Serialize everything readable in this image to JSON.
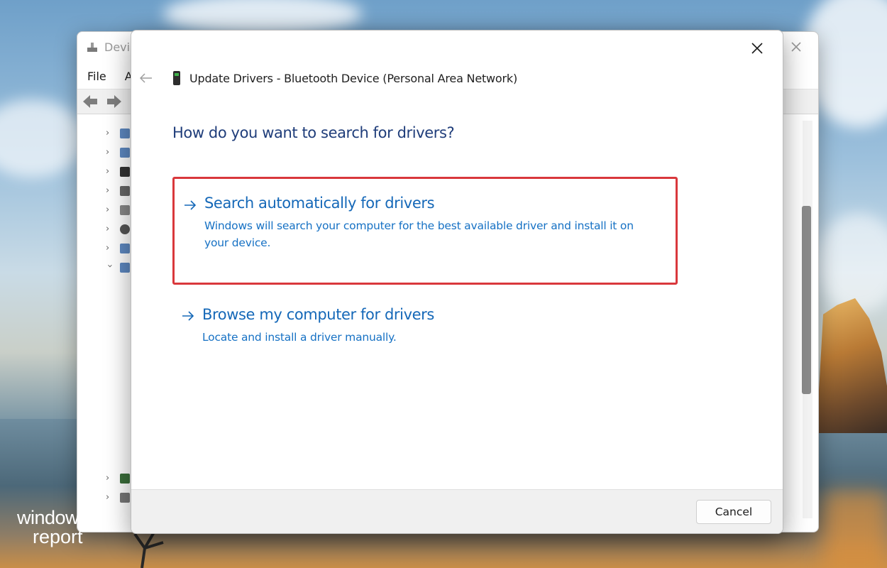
{
  "background_window": {
    "title": "Devi",
    "menu": [
      "File",
      "A"
    ],
    "tree_rows": 8
  },
  "dialog": {
    "title": "Update Drivers - Bluetooth Device (Personal Area Network)",
    "question": "How do you want to search for drivers?",
    "options": [
      {
        "title": "Search automatically for drivers",
        "description": "Windows will search your computer for the best available driver and install it on your device.",
        "highlighted": true,
        "highlight_color": "#d9383c"
      },
      {
        "title": "Browse my computer for drivers",
        "description": "Locate and install a driver manually.",
        "highlighted": false
      }
    ],
    "cancel_label": "Cancel"
  },
  "watermark": {
    "line1": "windows",
    "line2": "report"
  },
  "colors": {
    "link_blue": "#1568b8",
    "heading_blue": "#1f3d7a",
    "highlight_red": "#d9383c"
  },
  "icons": {
    "back": "back-arrow-icon",
    "device": "bluetooth-device-icon",
    "option_arrow": "right-arrow-icon",
    "close": "close-icon"
  }
}
